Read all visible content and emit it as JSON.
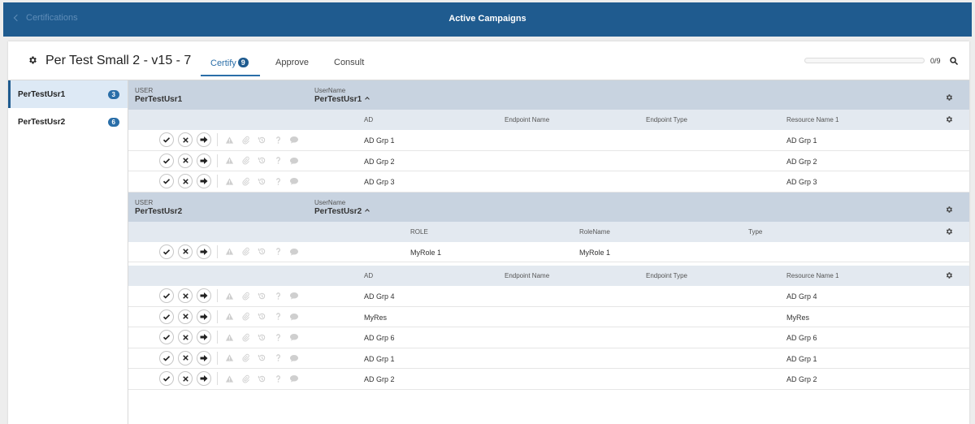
{
  "topbar": {
    "back_label": "Certifications",
    "title": "Active Campaigns"
  },
  "campaign": {
    "title": "Per Test Small 2 - v15 - 7"
  },
  "tabs": [
    {
      "label": "Certify",
      "badge": "9"
    },
    {
      "label": "Approve"
    },
    {
      "label": "Consult"
    }
  ],
  "progress": {
    "text": "0/9",
    "fraction": 0
  },
  "sidebar": {
    "items": [
      {
        "label": "PerTestUsr1",
        "count": "3"
      },
      {
        "label": "PerTestUsr2",
        "count": "6"
      }
    ]
  },
  "users": [
    {
      "user_label": "USER",
      "user_value": "PerTestUsr1",
      "username_label": "UserName",
      "username_value": "PerTestUsr1",
      "groups": [
        {
          "columns": [
            "AD",
            "Endpoint Name",
            "Endpoint Type",
            "Resource Name 1"
          ],
          "rows": [
            [
              "AD Grp 1",
              "",
              "",
              "AD Grp 1"
            ],
            [
              "AD Grp 2",
              "",
              "",
              "AD Grp 2"
            ],
            [
              "AD Grp 3",
              "",
              "",
              "AD Grp 3"
            ]
          ]
        }
      ]
    },
    {
      "user_label": "USER",
      "user_value": "PerTestUsr2",
      "username_label": "UserName",
      "username_value": "PerTestUsr2",
      "groups": [
        {
          "columns": [
            "ROLE",
            "RoleName",
            "Type"
          ],
          "rows": [
            [
              "MyRole 1",
              "MyRole 1",
              ""
            ]
          ]
        },
        {
          "columns": [
            "AD",
            "Endpoint Name",
            "Endpoint Type",
            "Resource Name 1"
          ],
          "rows": [
            [
              "AD Grp 4",
              "",
              "",
              "AD Grp 4"
            ],
            [
              "MyRes",
              "",
              "",
              "MyRes"
            ],
            [
              "AD Grp 6",
              "",
              "",
              "AD Grp 6"
            ],
            [
              "AD Grp 1",
              "",
              "",
              "AD Grp 1"
            ],
            [
              "AD Grp 2",
              "",
              "",
              "AD Grp 2"
            ]
          ]
        }
      ]
    }
  ],
  "icons": {
    "row_actions": [
      "check-icon",
      "close-icon",
      "arrow-right-icon"
    ],
    "row_tools": [
      "warning-icon",
      "paperclip-icon",
      "history-icon",
      "help-icon",
      "comment-icon"
    ]
  },
  "colors": {
    "brand": "#1f5b8f",
    "accent": "#2a6ea8",
    "user_header_bg": "#c8d3e0",
    "col_header_bg": "#e3e9f0"
  }
}
